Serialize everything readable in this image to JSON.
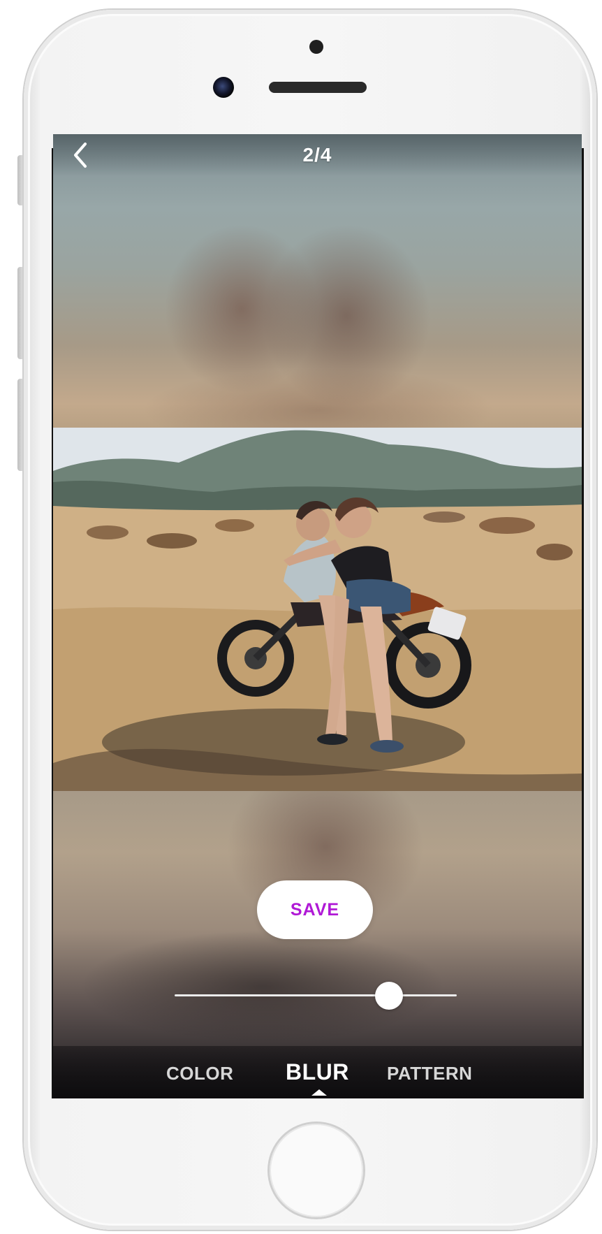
{
  "header": {
    "back_icon": "chevron-left-icon",
    "page_indicator": "2/4"
  },
  "actions": {
    "save_label": "SAVE"
  },
  "blur_slider": {
    "value": 0.76
  },
  "tabs": [
    {
      "label": "COLOR",
      "selected": false
    },
    {
      "label": "BLUR",
      "selected": true
    },
    {
      "label": "PATTERN",
      "selected": false
    }
  ],
  "colors": {
    "save_text": "#b019d6",
    "tab_active": "#ffffff",
    "tab_inactive": "#d7d7d7"
  },
  "device": {
    "model_style": "white-phone-frame",
    "home_button_icon": "home-button"
  }
}
